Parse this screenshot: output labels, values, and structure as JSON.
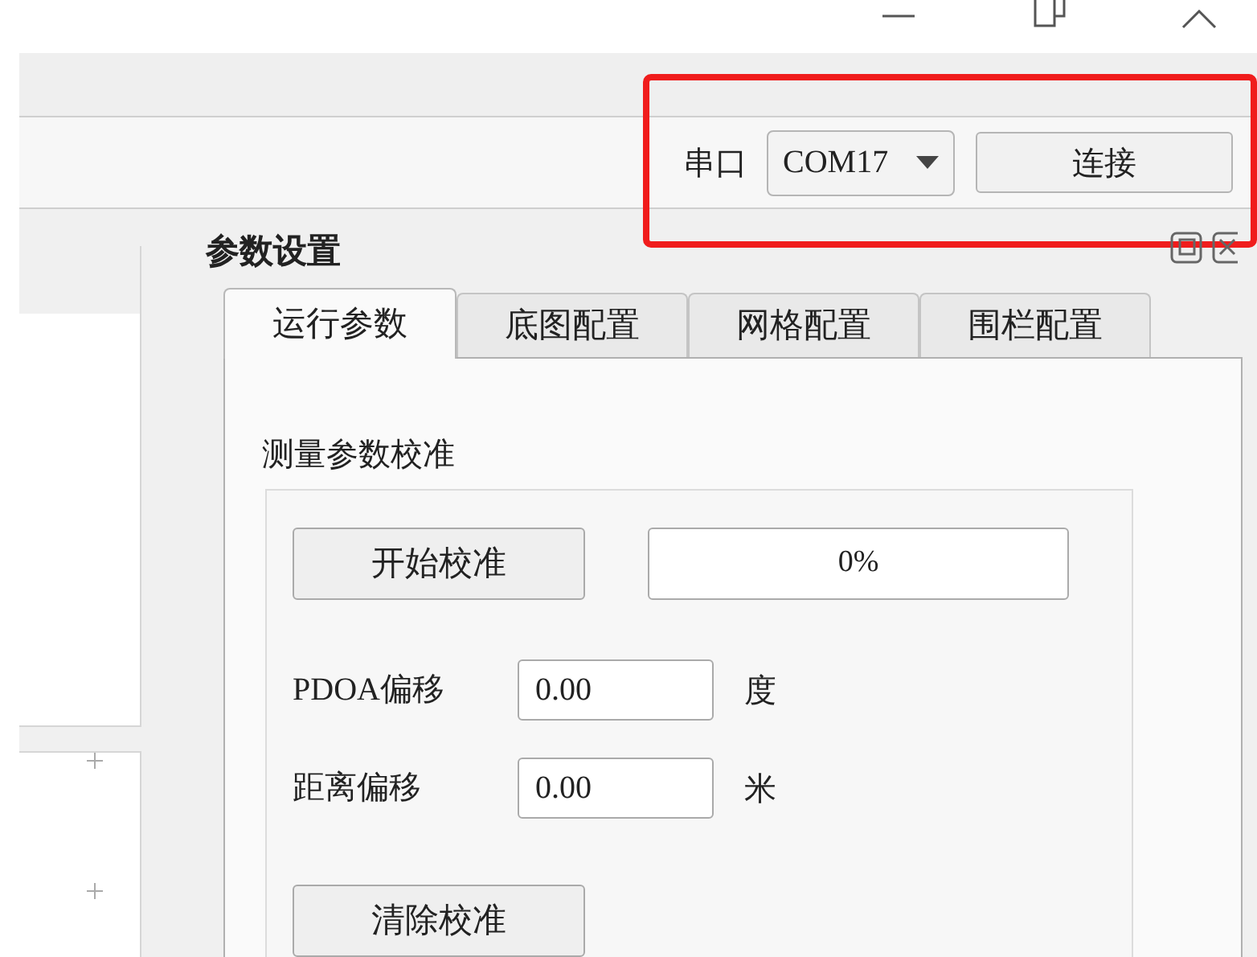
{
  "serial": {
    "label": "串口",
    "port": "COM17",
    "connect_button": "连接"
  },
  "dock": {
    "title": "参数设置",
    "tabs": [
      {
        "label": "运行参数",
        "selected": true
      },
      {
        "label": "底图配置",
        "selected": false
      },
      {
        "label": "网格配置",
        "selected": false
      },
      {
        "label": "围栏配置",
        "selected": false
      }
    ],
    "section_title": "测量参数校准",
    "calibrate_button": "开始校准",
    "progress": {
      "level": 0,
      "text": "0%"
    },
    "fields": [
      {
        "label": "PDOA偏移",
        "value": "0.00",
        "unit": "度"
      },
      {
        "label": "距离偏移",
        "value": "0.00",
        "unit": "米"
      }
    ],
    "clear_button": "清除校准"
  }
}
